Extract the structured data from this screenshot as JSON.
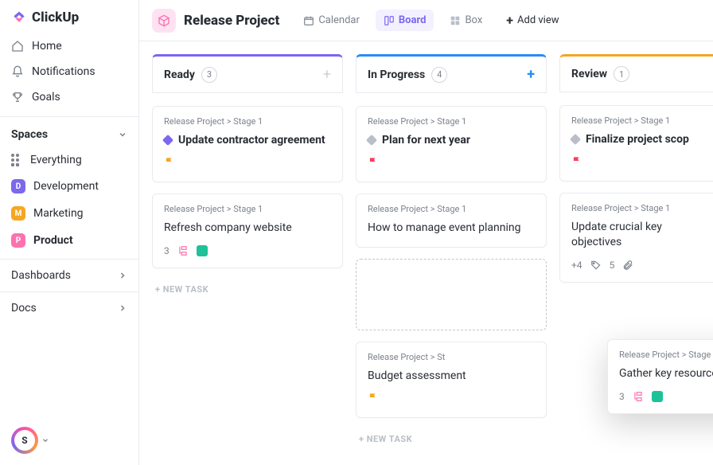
{
  "brand": {
    "name": "ClickUp"
  },
  "nav": {
    "home": "Home",
    "notifications": "Notifications",
    "goals": "Goals"
  },
  "spaces": {
    "label": "Spaces",
    "everything": "Everything",
    "items": [
      {
        "letter": "D",
        "label": "Development",
        "color": "#7b68ee"
      },
      {
        "letter": "M",
        "label": "Marketing",
        "color": "#f5a623"
      },
      {
        "letter": "P",
        "label": "Product",
        "color": "#fd71af",
        "active": true
      }
    ]
  },
  "bottom": {
    "dashboards": "Dashboards",
    "docs": "Docs"
  },
  "avatar": {
    "letter": "S"
  },
  "header": {
    "project": "Release Project",
    "views": {
      "calendar": "Calendar",
      "board": "Board",
      "box": "Box",
      "add": "Add view"
    }
  },
  "board": {
    "crumb": "Release Project > Stage 1",
    "newtask": "+ NEW TASK",
    "columns": [
      {
        "key": "ready",
        "label": "Ready",
        "count": "3",
        "color": "#7b68ee"
      },
      {
        "key": "inprogress",
        "label": "In Progress",
        "count": "4",
        "color": "#2a8cf5"
      },
      {
        "key": "review",
        "label": "Review",
        "count": "1",
        "color": "#f5a623"
      }
    ],
    "ready": [
      {
        "title": "Update contractor agreement",
        "diamond": "#7b68ee",
        "flag": "#f5a623",
        "bold": true
      },
      {
        "title": "Refresh company website",
        "subCount": "3",
        "chat": "#1ec198"
      }
    ],
    "inprogress": [
      {
        "title": "Plan for next year",
        "diamond": "#b9bec7",
        "flag": "#fd3b59",
        "bold": true
      },
      {
        "title": "How to manage event planning"
      },
      {
        "title": "Budget assessment",
        "flag": "#f5a623",
        "crumbShort": "Release Project > St"
      }
    ],
    "review": [
      {
        "title": "Finalize project scop",
        "diamond": "#b9bec7",
        "flag": "#fd3b59",
        "bold": true
      },
      {
        "title": "Update crucial key objectives",
        "meta1": "+4",
        "meta2": "5"
      }
    ],
    "drag": {
      "title": "Gather key resources",
      "subCount": "3",
      "chat": "#1ec198"
    }
  }
}
